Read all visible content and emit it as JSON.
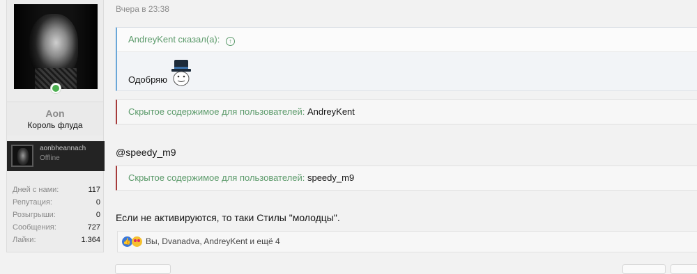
{
  "user": {
    "name": "Aon",
    "title": "Король флуда",
    "online": true
  },
  "steam": {
    "name": "aonbheannach",
    "status": "Offline"
  },
  "stats": [
    {
      "label": "Дней с нами:",
      "value": "117"
    },
    {
      "label": "Репутация:",
      "value": "0"
    },
    {
      "label": "Розыгрыши:",
      "value": "0"
    },
    {
      "label": "Сообщения:",
      "value": "727"
    },
    {
      "label": "Лайки:",
      "value": "1.364"
    }
  ],
  "post": {
    "timestamp": "Вчера в 23:38",
    "quote": {
      "author": "AndreyKent сказал(а):",
      "up_icon": "↑",
      "text": "Одобряю"
    },
    "hidden1": {
      "label": "Скрытое содержимое для пользователей:",
      "users": "AndreyKent"
    },
    "mention": "@speedy_m9",
    "hidden2": {
      "label": "Скрытое содержимое для пользователей:",
      "users": "speedy_m9"
    },
    "body": "Если не активируются, то таки Стилы \"молодцы\".",
    "reactions": {
      "like_icon": "👍",
      "text": "Вы, Dvanadva, AndreyKent и ещё 4"
    }
  },
  "colors": {
    "accent_green": "#5b9a6a",
    "quote_border": "#6aa7d8",
    "hidden_border": "#a63b3b",
    "online": "#4caf50"
  }
}
